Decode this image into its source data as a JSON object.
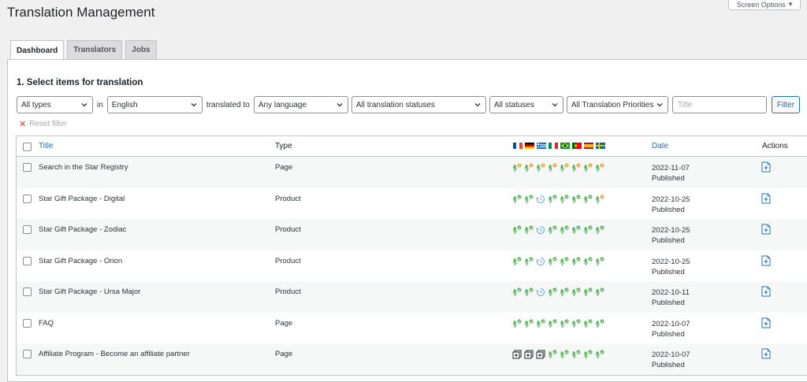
{
  "page": {
    "title": "Translation Management",
    "screen_options": "Screen Options"
  },
  "tabs": [
    {
      "label": "Dashboard",
      "active": true
    },
    {
      "label": "Translators",
      "active": false
    },
    {
      "label": "Jobs",
      "active": false
    }
  ],
  "section": {
    "title": "1. Select items for translation"
  },
  "filters": {
    "types": "All types",
    "in_text": "in",
    "source_language": "English",
    "translated_to_text": "translated to",
    "target_language": "Any language",
    "translation_status": "All translation statuses",
    "status": "All statuses",
    "priority": "All Translation Priorities",
    "search_placeholder": "Title",
    "filter_button": "Filter",
    "reset_filter": "Reset filter"
  },
  "table": {
    "headers": {
      "title": "Title",
      "type": "Type",
      "date": "Date",
      "actions": "Actions"
    },
    "languages": [
      "fr",
      "de",
      "el",
      "it",
      "br",
      "pt",
      "es",
      "se"
    ],
    "rows": [
      {
        "title": "Search in the Star Registry",
        "type": "Page",
        "date": "2022-11-07",
        "status": "Published",
        "translations": [
          "needs-update",
          "needs-update",
          "needs-update",
          "needs-update",
          "needs-update",
          "needs-update",
          "needs-update",
          "needs-update"
        ]
      },
      {
        "title": "Star Gift Package - Digital",
        "type": "Product",
        "date": "2022-10-25",
        "status": "Published",
        "translations": [
          "complete",
          "complete",
          "in-progress",
          "complete",
          "complete",
          "complete",
          "complete",
          "needs-update"
        ]
      },
      {
        "title": "Star Gift Package - Zodiac",
        "type": "Product",
        "date": "2022-10-25",
        "status": "Published",
        "translations": [
          "complete",
          "complete",
          "in-progress",
          "complete",
          "complete",
          "complete",
          "complete",
          "complete"
        ]
      },
      {
        "title": "Star Gift Package - Orion",
        "type": "Product",
        "date": "2022-10-25",
        "status": "Published",
        "translations": [
          "complete",
          "complete",
          "in-progress",
          "complete",
          "complete",
          "complete",
          "complete",
          "complete"
        ]
      },
      {
        "title": "Star Gift Package - Ursa Major",
        "type": "Product",
        "date": "2022-10-11",
        "status": "Published",
        "translations": [
          "complete",
          "complete",
          "in-progress",
          "complete",
          "complete",
          "complete",
          "complete",
          "complete"
        ]
      },
      {
        "title": "FAQ",
        "type": "Page",
        "date": "2022-10-07",
        "status": "Published",
        "translations": [
          "complete",
          "complete",
          "complete",
          "complete",
          "complete",
          "complete",
          "complete",
          "complete"
        ]
      },
      {
        "title": "Affiliate Program - Become an affiliate partner",
        "type": "Page",
        "date": "2022-10-07",
        "status": "Published",
        "translations": [
          "add",
          "add",
          "add",
          "complete",
          "complete",
          "complete",
          "complete",
          "complete"
        ]
      }
    ]
  },
  "colors": {
    "link": "#2271b1",
    "complete": "#4caf50",
    "needs_update": "#e0a030",
    "in_progress": "#6aa8d8"
  },
  "icons": {
    "action": "add-translation-icon",
    "chevron": "chevron-down-icon"
  }
}
